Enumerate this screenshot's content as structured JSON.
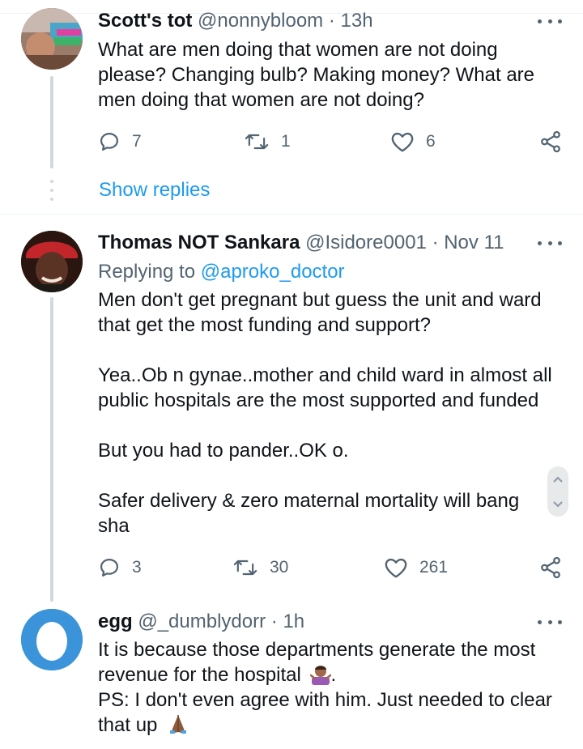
{
  "tweets": [
    {
      "name": "Scott's tot",
      "handle": "@nonnybloom",
      "time": "· 13h",
      "text": [
        "What are men doing that women are not doing please? Changing bulb? Making money? What are men doing that women are not doing?"
      ],
      "replies": "7",
      "retweets": "1",
      "likes": "6",
      "show_replies": "Show replies"
    },
    {
      "name": "Thomas NOT Sankara",
      "handle": "@Isidore0001",
      "time": "· Nov 11",
      "replying_label": "Replying to",
      "replying_handle": "@aproko_doctor",
      "text": [
        "Men don't get pregnant but guess the unit and ward that get the most funding and support?",
        "Yea..Ob n gynae..mother and child ward in almost all public hospitals are the most supported and funded",
        "But you had to pander..OK o.",
        "Safer delivery & zero maternal mortality will bang sha"
      ],
      "replies": "3",
      "retweets": "30",
      "likes": "261"
    },
    {
      "name": "egg",
      "handle": "@_dumblydorr",
      "time": "· 1h",
      "text": [
        "It is because those departments generate the most revenue for the hospital",
        ".",
        "PS: I don't even agree with him. Just needed to clear that up"
      ]
    }
  ],
  "colors": {
    "link": "#1d9bf0",
    "muted": "#536471",
    "thread_line": "#cfd9de",
    "egg_avatar": "#3b94d9"
  },
  "icons": [
    "reply-icon",
    "retweet-icon",
    "like-icon",
    "share-icon",
    "more-icon",
    "shrug-emoji",
    "pray-emoji"
  ]
}
